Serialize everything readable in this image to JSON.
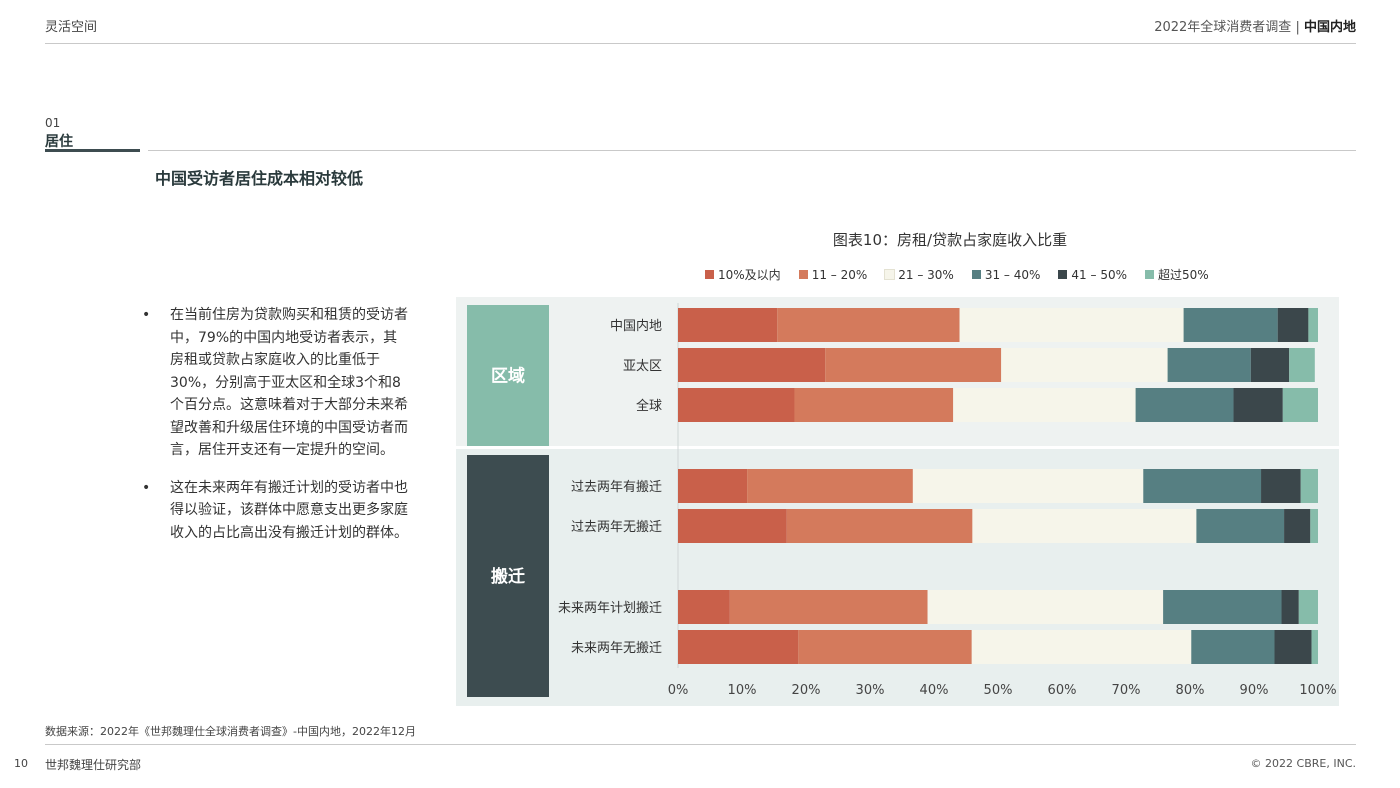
{
  "header": {
    "left": "灵活空间",
    "right_main": "2022年全球消费者调查",
    "right_sep": "|",
    "right_bold": "中国内地"
  },
  "section": {
    "number": "01",
    "name": "居住",
    "title": "中国受访者居住成本相对较低"
  },
  "bullets": [
    {
      "marker": "•",
      "text": "在当前住房为贷款购买和租赁的受访者中，79%的中国内地受访者表示，其房租或贷款占家庭收入的比重低于30%，分别高于亚太区和全球3个和8个百分点。这意味着对于大部分未来希望改善和升级居住环境的中国受访者而言，居住开支还有一定提升的空间。"
    },
    {
      "marker": "•",
      "text": "这在未来两年有搬迁计划的受访者中也得以验证，该群体中愿意支出更多家庭收入的占比高出没有搬迁计划的群体。"
    }
  ],
  "chart_data": {
    "type": "bar",
    "orientation": "horizontal",
    "stacked": true,
    "title": "图表10：房租/贷款占家庭收入比重",
    "legend_position": "top",
    "xlim": [
      0,
      100
    ],
    "x_ticks": [
      "0%",
      "10%",
      "20%",
      "30%",
      "40%",
      "50%",
      "60%",
      "70%",
      "80%",
      "90%",
      "100%"
    ],
    "series_names": [
      "10%及以内",
      "11 – 20%",
      "21 – 30%",
      "31 – 40%",
      "41 – 50%",
      "超过50%"
    ],
    "colors": [
      "#c9604a",
      "#d47a5c",
      "#f6f5ea",
      "#567f82",
      "#3b474b",
      "#86bcaa"
    ],
    "groups": [
      {
        "label": "区域",
        "color": "#86bcaa",
        "rows": [
          {
            "category": "中国内地",
            "values": [
              15.5,
              28.5,
              35,
              14.7,
              4.8,
              1.5
            ]
          },
          {
            "category": "亚太区",
            "values": [
              23,
              27.5,
              26,
              13,
              6,
              4
            ]
          },
          {
            "category": "全球",
            "values": [
              18.2,
              24.8,
              28.5,
              15.3,
              7.7,
              5.5
            ]
          }
        ]
      },
      {
        "label": "搬迁",
        "color": "#3d4c50",
        "rows": [
          {
            "category": "过去两年有搬迁",
            "values": [
              10.8,
              25.9,
              36,
              18.4,
              6.2,
              2.7
            ]
          },
          {
            "category": "过去两年无搬迁",
            "values": [
              17,
              29,
              35,
              13.7,
              4.1,
              1.2
            ]
          },
          {
            "category": "未来两年计划搬迁",
            "values": [
              8.1,
              30.9,
              36.8,
              18.5,
              2.7,
              3
            ]
          },
          {
            "category": "未来两年无搬迁",
            "values": [
              18.8,
              27.1,
              34.3,
              13,
              5.8,
              1
            ]
          }
        ]
      }
    ]
  },
  "footer": {
    "source": "数据来源：2022年《世邦魏理仕全球消费者调查》-中国内地，2022年12月",
    "page_number": "10",
    "left": "世邦魏理仕研究部",
    "right": "© 2022 CBRE, INC."
  }
}
